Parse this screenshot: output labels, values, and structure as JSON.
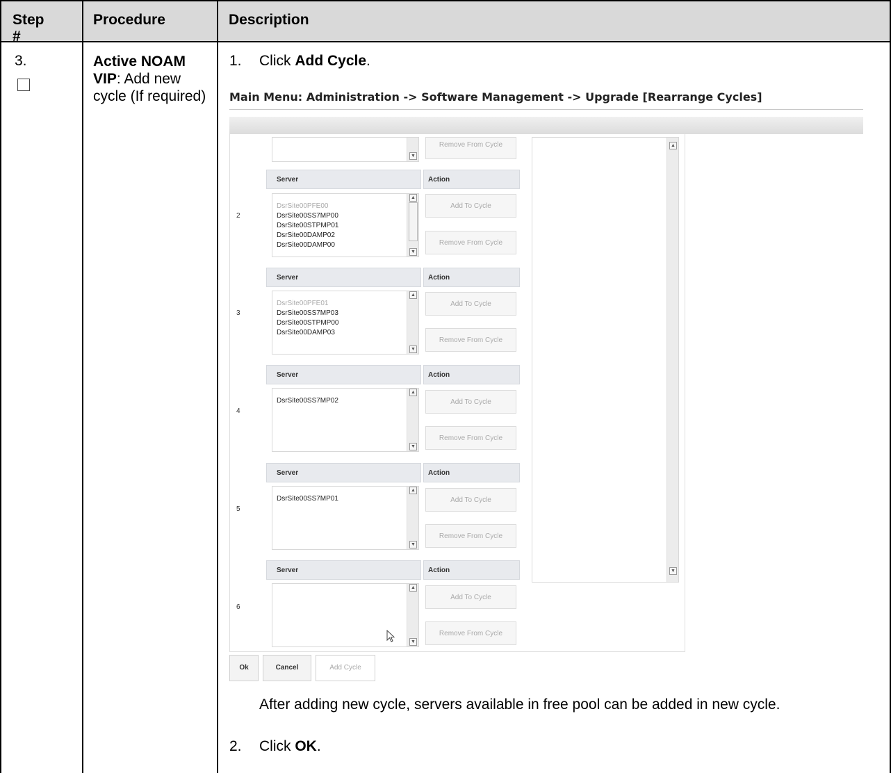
{
  "table": {
    "headers": {
      "step": "Step #",
      "procedure": "Procedure",
      "description": "Description"
    },
    "row": {
      "step_number": "3.",
      "procedure_bold": "Active NOAM VIP",
      "procedure_rest": ": Add new cycle (If required)",
      "step1_num": "1.",
      "step1_pre": "Click ",
      "step1_bold": "Add Cycle",
      "step1_post": ".",
      "note": "After adding new cycle, servers available in free pool can be added in new cycle.",
      "step2_num": "2.",
      "step2_pre": "Click ",
      "step2_bold": "OK",
      "step2_post": "."
    }
  },
  "screenshot": {
    "title": "Main Menu: Administration -> Software Management -> Upgrade [Rearrange Cycles]",
    "server_header": "Server",
    "action_header": "Action",
    "add_to_cycle": "Add To Cycle",
    "remove_from_cycle": "Remove From Cycle",
    "cycles": [
      {
        "num": "2",
        "servers": [
          "DsrSite00PFE00",
          "DsrSite00SS7MP00",
          "DsrSite00STPMP01",
          "DsrSite00DAMP02",
          "DsrSite00DAMP00"
        ]
      },
      {
        "num": "3",
        "servers": [
          "DsrSite00PFE01",
          "DsrSite00SS7MP03",
          "DsrSite00STPMP00",
          "DsrSite00DAMP03"
        ]
      },
      {
        "num": "4",
        "servers": [
          "DsrSite00SS7MP02"
        ]
      },
      {
        "num": "5",
        "servers": [
          "DsrSite00SS7MP01"
        ]
      },
      {
        "num": "6",
        "servers": []
      }
    ],
    "buttons": {
      "ok": "Ok",
      "cancel": "Cancel",
      "add_cycle": "Add Cycle"
    }
  }
}
